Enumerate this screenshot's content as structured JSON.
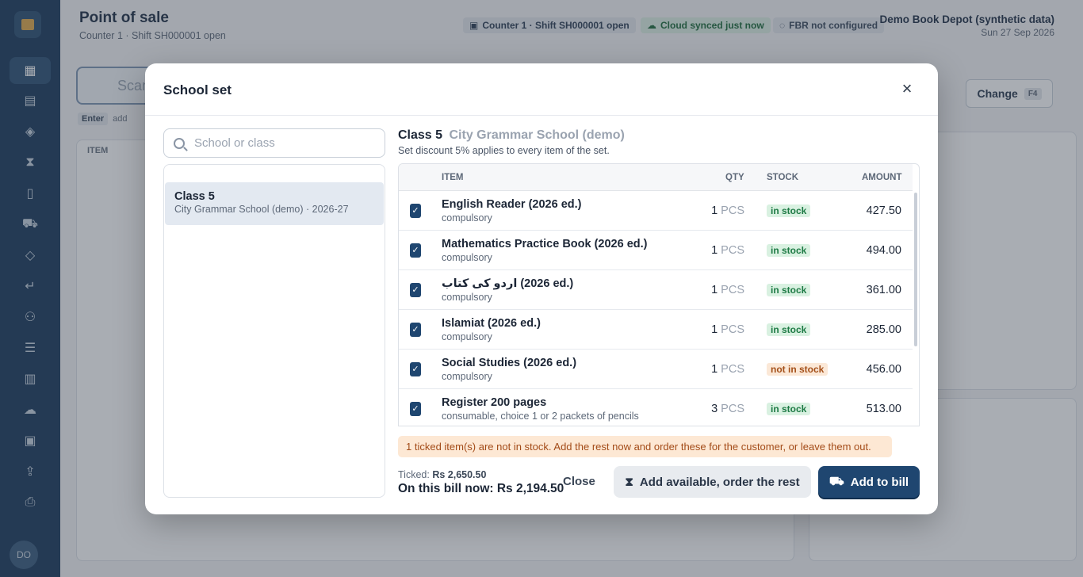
{
  "app": {
    "title": "Point of sale",
    "subtitle": "Counter 1 · Shift SH000001 open",
    "chips": {
      "counter": "Counter 1 · Shift SH000001 open",
      "cloud": "Cloud synced just now",
      "fbr": "FBR not configured"
    },
    "shop_name": "Demo Book Depot (synthetic data)",
    "date": "Sun 27 Sep 2026",
    "scan_placeholder": "Scan",
    "enter_key": "Enter",
    "enter_hint": "add",
    "table_header_item": "ITEM",
    "change_label": "Change",
    "change_key": "F4",
    "user_initials": "DO"
  },
  "modal": {
    "title": "School set",
    "search_placeholder": "School or class",
    "list_items": [
      {
        "title": "Class 5",
        "subtitle": "City Grammar School (demo) · 2026-27"
      }
    ],
    "set_class": "Class 5",
    "set_school": "City Grammar School (demo)",
    "set_note": "Set discount 5% applies to every item of the set.",
    "columns": {
      "item": "ITEM",
      "qty": "QTY",
      "stock": "STOCK",
      "amount": "AMOUNT"
    },
    "rows": [
      {
        "name": "English Reader (2026 ed.)",
        "sub": "compulsory",
        "qty": "1",
        "unit": "PCS",
        "stock": "in stock",
        "amount": "427.50"
      },
      {
        "name": "Mathematics Practice Book (2026 ed.)",
        "sub": "compulsory",
        "qty": "1",
        "unit": "PCS",
        "stock": "in stock",
        "amount": "494.00"
      },
      {
        "name": "اردو کی کتاب (2026 ed.)",
        "sub": "compulsory",
        "qty": "1",
        "unit": "PCS",
        "stock": "in stock",
        "amount": "361.00"
      },
      {
        "name": "Islamiat (2026 ed.)",
        "sub": "compulsory",
        "qty": "1",
        "unit": "PCS",
        "stock": "in stock",
        "amount": "285.00"
      },
      {
        "name": "Social Studies (2026 ed.)",
        "sub": "compulsory",
        "qty": "1",
        "unit": "PCS",
        "stock": "not in stock",
        "amount": "456.00"
      },
      {
        "name": "Register 200 pages",
        "sub": "consumable, choice 1 or 2 packets of pencils",
        "qty": "3",
        "unit": "PCS",
        "stock": "in stock",
        "amount": "513.00"
      }
    ],
    "warning": "1 ticked item(s) are not in stock. Add the rest now and order these for the customer, or leave them out.",
    "ticked_label": "Ticked:",
    "ticked_value": "Rs 2,650.50",
    "bill_now": "On this bill now: Rs 2,194.50",
    "close_label": "Close",
    "avail_label": "Add available, order the rest",
    "add_label": "Add to bill"
  },
  "colors": {
    "rail": "#1b3a5c",
    "accent": "#1f4670",
    "in_stock": "#1d7a44",
    "not_in_stock": "#a4501a"
  }
}
